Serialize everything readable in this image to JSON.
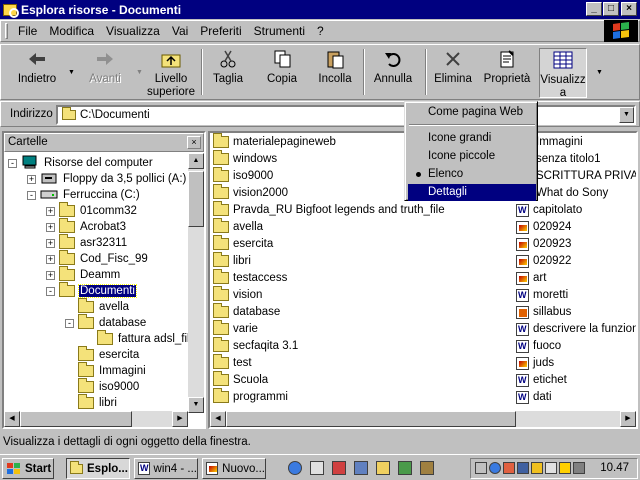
{
  "window": {
    "title": "Esplora risorse - Documenti",
    "controls": {
      "minimize": "_",
      "maximize": "□",
      "close": "×"
    }
  },
  "menu": [
    "File",
    "Modifica",
    "Visualizza",
    "Vai",
    "Preferiti",
    "Strumenti",
    "?"
  ],
  "toolbar": {
    "back": "Indietro",
    "forward": "Avanti",
    "up_line1": "Livello",
    "up_line2": "superiore",
    "cut": "Taglia",
    "copy": "Copia",
    "paste": "Incolla",
    "undo": "Annulla",
    "delete": "Elimina",
    "properties": "Proprietà",
    "views_line1": "Visualizz",
    "views_line2": "a"
  },
  "address": {
    "label": "Indirizzo",
    "value": "C:\\Documenti"
  },
  "views_menu": {
    "items": [
      "Come pagina Web",
      "Icone grandi",
      "Icone piccole",
      "Elenco",
      "Dettagli"
    ],
    "checked": "Elenco",
    "highlighted": "Dettagli"
  },
  "tree": {
    "header": "Cartelle",
    "close": "×",
    "nodes": [
      {
        "label": "Risorse del computer",
        "icon": "computer-icon",
        "expander": "-"
      },
      {
        "label": "Floppy da 3,5 pollici (A:)",
        "icon": "floppy-icon",
        "expander": "+"
      },
      {
        "label": "Ferruccina (C:)",
        "icon": "drive-icon",
        "expander": "-"
      },
      {
        "label": "01comm32",
        "icon": "folder-icon",
        "expander": "+"
      },
      {
        "label": "Acrobat3",
        "icon": "folder-icon",
        "expander": "+"
      },
      {
        "label": "asr32311",
        "icon": "folder-icon",
        "expander": "+"
      },
      {
        "label": "Cod_Fisc_99",
        "icon": "folder-icon",
        "expander": "+"
      },
      {
        "label": "Deamm",
        "icon": "folder-icon",
        "expander": "+"
      },
      {
        "label": "Documenti",
        "icon": "open-folder-icon",
        "expander": "-"
      },
      {
        "label": "avella",
        "icon": "folder-icon",
        "expander": ""
      },
      {
        "label": "database",
        "icon": "folder-icon",
        "expander": "-"
      },
      {
        "label": "fattura adsl_file",
        "icon": "folder-icon",
        "expander": ""
      },
      {
        "label": "esercita",
        "icon": "folder-icon",
        "expander": ""
      },
      {
        "label": "Immagini",
        "icon": "folder-icon",
        "expander": ""
      },
      {
        "label": "iso9000",
        "icon": "folder-icon",
        "expander": ""
      },
      {
        "label": "libri",
        "icon": "folder-icon",
        "expander": ""
      }
    ]
  },
  "files_col1": [
    "materialepagineweb",
    "windows",
    "iso9000",
    "vision2000",
    "Pravda_RU Bigfoot legends and truth_file",
    "avella",
    "esercita",
    "libri",
    "testaccess",
    "vision",
    "database",
    "varie",
    "secfaqita 3.1",
    "test",
    "Scuola",
    "programmi"
  ],
  "files_col2": [
    {
      "name": "Immagini",
      "icon": "folder-icon"
    },
    {
      "name": "senza titolo1",
      "icon": "folder-icon"
    },
    {
      "name": "SCRITTURA PRIVATA",
      "icon": "folder-icon"
    },
    {
      "name": "What do Sony",
      "icon": "folder-icon"
    },
    {
      "name": "capitolato",
      "icon": "word-doc-icon"
    },
    {
      "name": "020924",
      "icon": "image-file-icon"
    },
    {
      "name": "020923",
      "icon": "image-file-icon"
    },
    {
      "name": "020922",
      "icon": "image-file-icon"
    },
    {
      "name": "art",
      "icon": "image-file-icon"
    },
    {
      "name": "moretti",
      "icon": "word-doc-icon"
    },
    {
      "name": "sillabus",
      "icon": "ppt-file-icon"
    },
    {
      "name": "descrivere la funzione",
      "icon": "word-doc-icon"
    },
    {
      "name": "fuoco",
      "icon": "word-doc-icon"
    },
    {
      "name": "juds",
      "icon": "image-file-icon"
    },
    {
      "name": "etichet",
      "icon": "word-doc-icon"
    },
    {
      "name": "dati",
      "icon": "word-doc-icon"
    }
  ],
  "status": "Visualizza i dettagli di ogni oggetto della finestra.",
  "taskbar": {
    "start": "Start",
    "tasks": [
      "Esplo...",
      "win4 - ...",
      "Nuovo..."
    ],
    "clock": "10.47"
  },
  "colors": {
    "title_bar": "#000080",
    "selection": "#000080",
    "face": "#c0c0c0"
  }
}
